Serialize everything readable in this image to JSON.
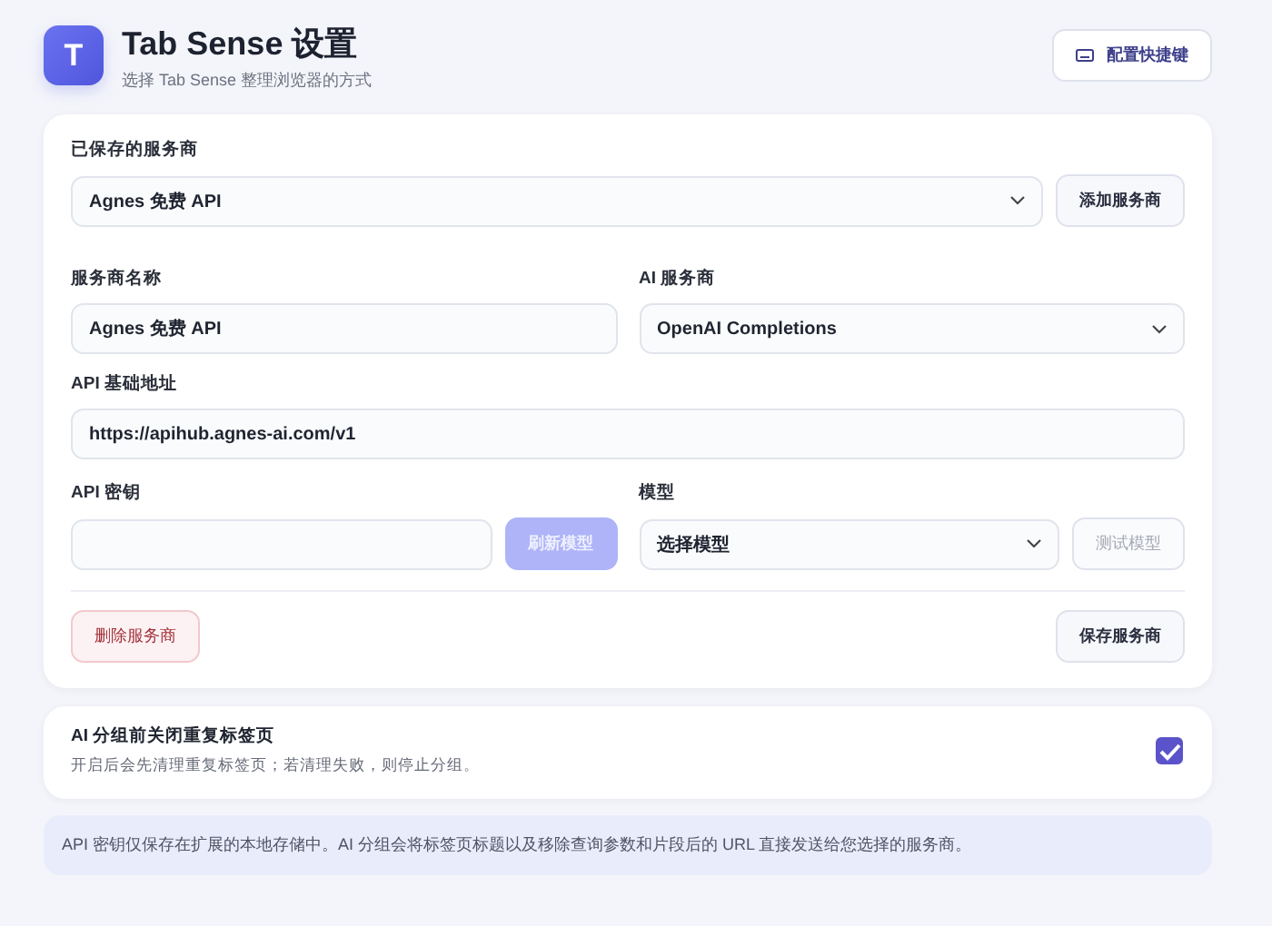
{
  "header": {
    "logo": "T",
    "title": "Tab Sense 设置",
    "subtitle": "选择 Tab Sense 整理浏览器的方式",
    "shortcut_button": "配置快捷键"
  },
  "provider_card": {
    "saved": {
      "label": "已保存的服务商",
      "value": "Agnes 免费 API",
      "add_button": "添加服务商"
    },
    "name": {
      "label": "服务商名称",
      "value": "Agnes 免费 API"
    },
    "ai_provider": {
      "label": "AI 服务商",
      "value": "OpenAI Completions"
    },
    "base_url": {
      "label": "API 基础地址",
      "value": "https://apihub.agnes-ai.com/v1"
    },
    "api_key": {
      "label": "API 密钥",
      "refresh_button": {
        "label": "刷新模型",
        "disabled": true
      }
    },
    "model": {
      "label": "模型",
      "value": "选择模型",
      "test_button": {
        "label": "测试模型",
        "disabled": true
      }
    },
    "delete_button": "删除服务商",
    "save_button": "保存服务商"
  },
  "dedupe_card": {
    "title": "AI 分组前关闭重复标签页",
    "description": "开启后会先清理重复标签页；若清理失败，则停止分组。",
    "checked": true
  },
  "note": "API 密钥仅保存在扩展的本地存储中。AI 分组会将标签页标题以及移除查询参数和片段后的 URL 直接发送给您选择的服务商。"
}
